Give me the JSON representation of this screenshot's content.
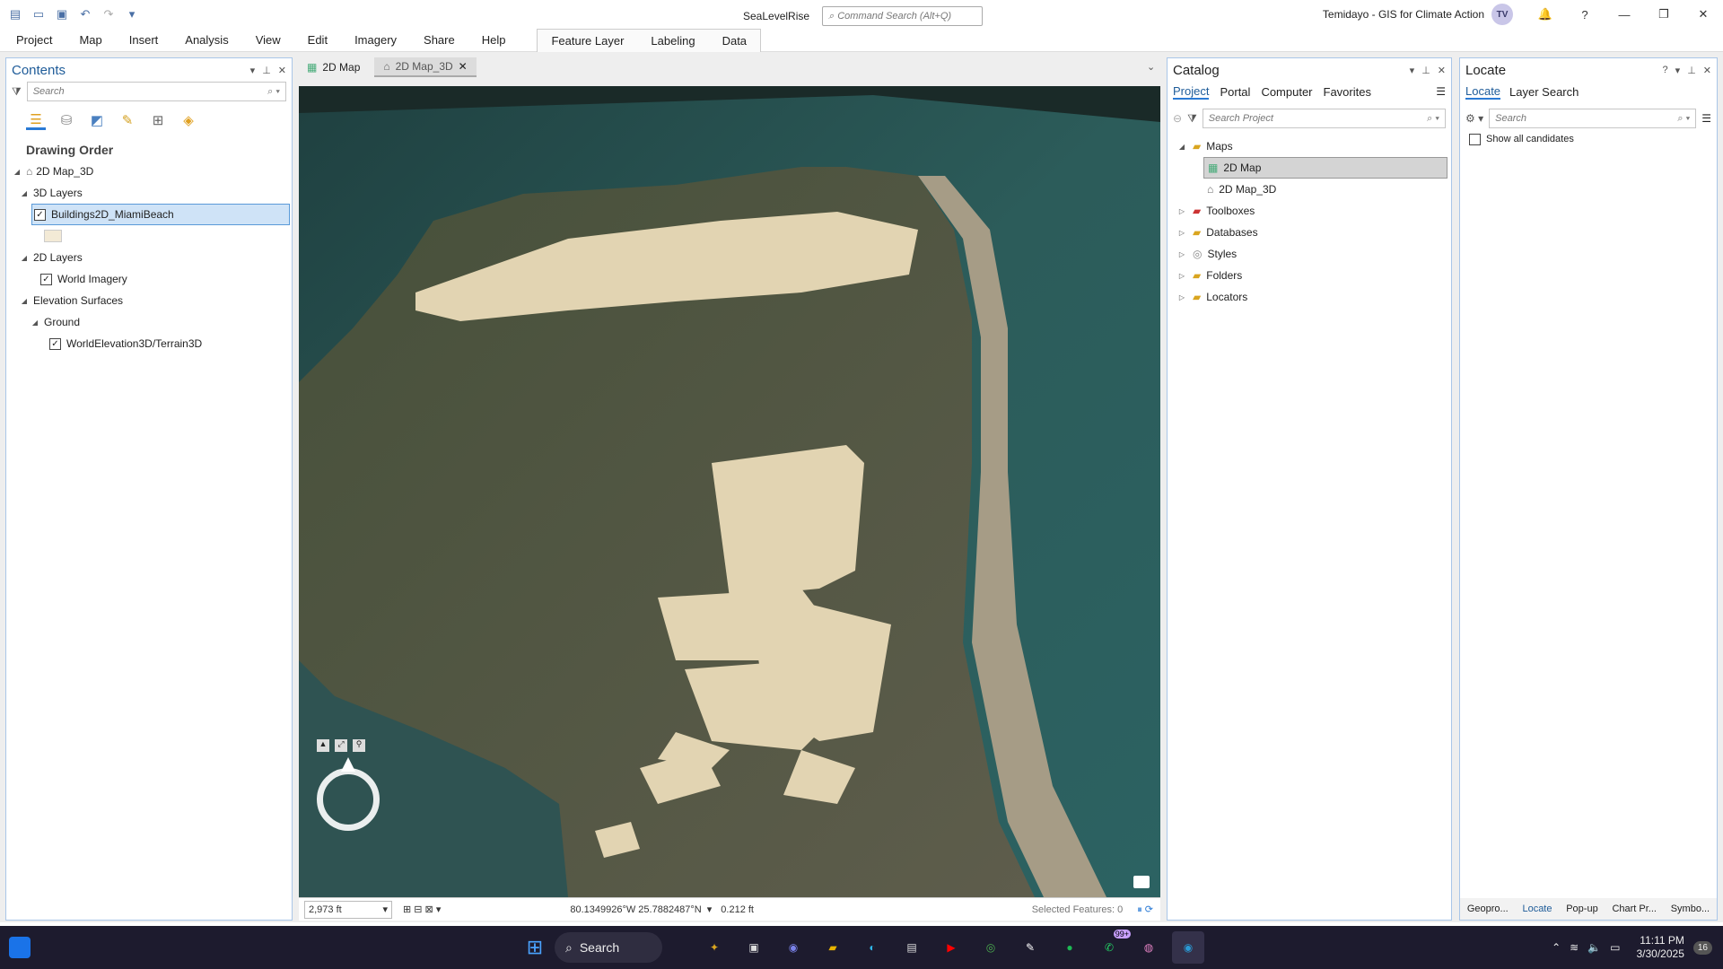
{
  "app": {
    "project": "SeaLevelRise",
    "command_search": "Command Search (Alt+Q)",
    "user": "Temidayo - GIS for Climate Action",
    "avatar": "TV"
  },
  "ribbon": {
    "tabs": [
      "Project",
      "Map",
      "Insert",
      "Analysis",
      "View",
      "Edit",
      "Imagery",
      "Share",
      "Help"
    ],
    "context_tabs": [
      "Feature Layer",
      "Labeling",
      "Data"
    ]
  },
  "contents": {
    "title": "Contents",
    "search_placeholder": "Search",
    "drawing_order": "Drawing Order",
    "map": "2D Map_3D",
    "group_3d": "3D Layers",
    "layer_buildings": "Buildings2D_MiamiBeach",
    "group_2d": "2D Layers",
    "layer_imagery": "World Imagery",
    "group_elev": "Elevation Surfaces",
    "ground": "Ground",
    "terrain": "WorldElevation3D/Terrain3D"
  },
  "doc_tabs": [
    {
      "label": "2D Map"
    },
    {
      "label": "2D Map_3D"
    }
  ],
  "map_status": {
    "scale": "2,973 ft",
    "coords": "80.1349926°W 25.7882487°N",
    "elevation": "0.212 ft",
    "selected": "Selected Features: 0"
  },
  "catalog": {
    "title": "Catalog",
    "tabs": [
      "Project",
      "Portal",
      "Computer",
      "Favorites"
    ],
    "search_placeholder": "Search Project",
    "items": {
      "maps": "Maps",
      "map2d": "2D Map",
      "map3d": "2D Map_3D",
      "toolboxes": "Toolboxes",
      "databases": "Databases",
      "styles": "Styles",
      "folders": "Folders",
      "locators": "Locators"
    }
  },
  "locate": {
    "title": "Locate",
    "tabs": [
      "Locate",
      "Layer Search"
    ],
    "search_placeholder": "Search",
    "show_all": "Show all candidates",
    "bottom_tabs": [
      "Geopro...",
      "Locate",
      "Pop-up",
      "Chart Pr...",
      "Symbo..."
    ]
  },
  "taskbar": {
    "search": "Search",
    "time": "11:11 PM",
    "date": "3/30/2025",
    "notif_badge": "99+",
    "count_badge": "16"
  },
  "colors": {
    "accent": "#2a7ad5",
    "pane_title": "#1f5c99",
    "selection": "#cfe3f7"
  }
}
